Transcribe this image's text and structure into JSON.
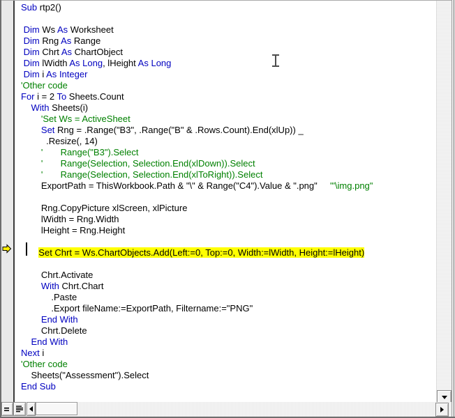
{
  "colors": {
    "keyword": "#0000C0",
    "comment": "#008000",
    "normal": "#000000",
    "exec_background": "#FFFF00",
    "exec_text": "#000000",
    "margin_background": "#E9E9E9",
    "scrollbar_background": "#F0F0F0"
  },
  "icons": {
    "execution_point_arrow": "yellow-right-arrow",
    "procedure_view": "two-horizontal-lines",
    "full_module_view": "four-horizontal-lines",
    "scroll_left": "left-triangle",
    "scroll_right": "right-triangle",
    "scroll_down": "down-triangle",
    "mouse_cursor": "text-ibeam"
  },
  "code": {
    "language": "VBA",
    "execution_line_index": 22,
    "lines": [
      {
        "s": [
          [
            "Sub",
            "k"
          ],
          [
            " rtp2()",
            "n"
          ]
        ]
      },
      {
        "s": []
      },
      {
        "s": [
          [
            " ",
            "n"
          ],
          [
            "Dim",
            "k"
          ],
          [
            " Ws ",
            "n"
          ],
          [
            "As",
            "k"
          ],
          [
            " Worksheet",
            "n"
          ]
        ]
      },
      {
        "s": [
          [
            " ",
            "n"
          ],
          [
            "Dim",
            "k"
          ],
          [
            " Rng ",
            "n"
          ],
          [
            "As",
            "k"
          ],
          [
            " Range",
            "n"
          ]
        ]
      },
      {
        "s": [
          [
            " ",
            "n"
          ],
          [
            "Dim",
            "k"
          ],
          [
            " Chrt ",
            "n"
          ],
          [
            "As",
            "k"
          ],
          [
            " ChartObject",
            "n"
          ]
        ]
      },
      {
        "s": [
          [
            " ",
            "n"
          ],
          [
            "Dim",
            "k"
          ],
          [
            " lWidth ",
            "n"
          ],
          [
            "As",
            "k"
          ],
          [
            " ",
            "n"
          ],
          [
            "Long",
            "k"
          ],
          [
            ", lHeight ",
            "n"
          ],
          [
            "As",
            "k"
          ],
          [
            " ",
            "n"
          ],
          [
            "Long",
            "k"
          ]
        ]
      },
      {
        "s": [
          [
            " ",
            "n"
          ],
          [
            "Dim",
            "k"
          ],
          [
            " i ",
            "n"
          ],
          [
            "As",
            "k"
          ],
          [
            " ",
            "n"
          ],
          [
            "Integer",
            "k"
          ]
        ]
      },
      {
        "s": [
          [
            "'Other code",
            "c"
          ]
        ]
      },
      {
        "s": [
          [
            "For",
            "k"
          ],
          [
            " i = 2 ",
            "n"
          ],
          [
            "To",
            "k"
          ],
          [
            " Sheets.Count",
            "n"
          ]
        ]
      },
      {
        "s": [
          [
            "    ",
            "n"
          ],
          [
            "With",
            "k"
          ],
          [
            " Sheets(i)",
            "n"
          ]
        ]
      },
      {
        "s": [
          [
            "        ",
            "n"
          ],
          [
            "'Set Ws = ActiveSheet",
            "c"
          ]
        ]
      },
      {
        "s": [
          [
            "        ",
            "n"
          ],
          [
            "Set",
            "k"
          ],
          [
            " Rng = .Range(\"B3\", .Range(\"B\" & .Rows.Count).End(xlUp)) _",
            "n"
          ]
        ]
      },
      {
        "s": [
          [
            "          .Resize(, 14)",
            "n"
          ]
        ]
      },
      {
        "s": [
          [
            "        ",
            "n"
          ],
          [
            "'       Range(\"B3\").Select",
            "c"
          ]
        ]
      },
      {
        "s": [
          [
            "        ",
            "n"
          ],
          [
            "'       Range(Selection, Selection.End(xlDown)).Select",
            "c"
          ]
        ]
      },
      {
        "s": [
          [
            "        ",
            "n"
          ],
          [
            "'       Range(Selection, Selection.End(xlToRight)).Select",
            "c"
          ]
        ]
      },
      {
        "s": [
          [
            "        ExportPath = ThisWorkbook.Path & \"\\\" & Range(\"C4\").Value & \".png\"",
            "n"
          ],
          [
            "     '\"\\img.png\"",
            "c"
          ]
        ]
      },
      {
        "s": []
      },
      {
        "s": [
          [
            "        Rng.CopyPicture xlScreen, xlPicture",
            "n"
          ]
        ]
      },
      {
        "s": [
          [
            "        lWidth = Rng.Width",
            "n"
          ]
        ]
      },
      {
        "s": [
          [
            "        lHeight = Rng.Height",
            "n"
          ]
        ]
      },
      {
        "s": []
      },
      {
        "s": [
          [
            "       ",
            "n"
          ],
          [
            "Set Chrt = Ws.ChartObjects.Add(Left:=0, Top:=0, Width:=lWidth, Height:=lHeight)",
            "x"
          ]
        ],
        "exec": true
      },
      {
        "s": []
      },
      {
        "s": [
          [
            "        Chrt.Activate",
            "n"
          ]
        ]
      },
      {
        "s": [
          [
            "        ",
            "n"
          ],
          [
            "With",
            "k"
          ],
          [
            " Chrt.Chart",
            "n"
          ]
        ]
      },
      {
        "s": [
          [
            "            .Paste",
            "n"
          ]
        ]
      },
      {
        "s": [
          [
            "            .Export fileName:=ExportPath, Filtername:=\"PNG\"",
            "n"
          ]
        ]
      },
      {
        "s": [
          [
            "        ",
            "n"
          ],
          [
            "End With",
            "k"
          ]
        ]
      },
      {
        "s": [
          [
            "        Chrt.Delete",
            "n"
          ]
        ]
      },
      {
        "s": [
          [
            "    ",
            "n"
          ],
          [
            "End With",
            "k"
          ]
        ]
      },
      {
        "s": [
          [
            "Next",
            "k"
          ],
          [
            " i",
            "n"
          ]
        ]
      },
      {
        "s": [
          [
            "'Other code",
            "c"
          ]
        ]
      },
      {
        "s": [
          [
            "    Sheets(\"Assessment\").Select",
            "n"
          ]
        ]
      },
      {
        "s": [
          [
            "End Sub",
            "k"
          ]
        ]
      }
    ]
  }
}
